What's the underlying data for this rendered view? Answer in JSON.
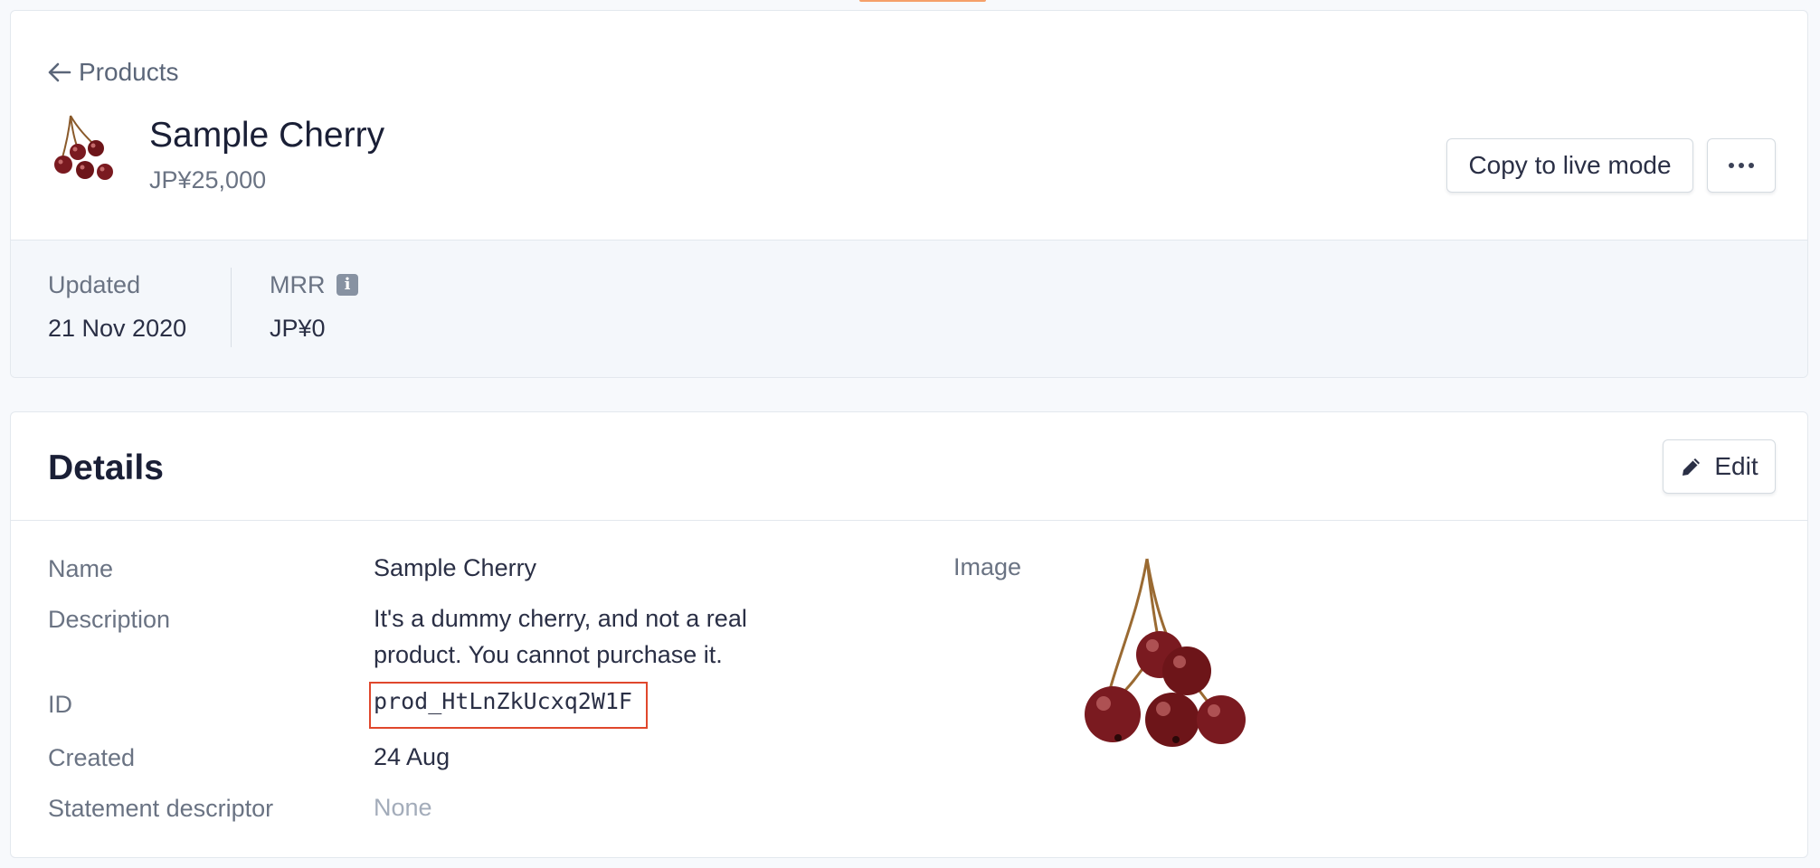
{
  "header": {
    "back_label": "Products",
    "product_name": "Sample Cherry",
    "price": "JP¥25,000",
    "copy_button_label": "Copy to live mode"
  },
  "stats": {
    "updated_label": "Updated",
    "updated_value": "21 Nov 2020",
    "mrr_label": "MRR",
    "mrr_value": "JP¥0"
  },
  "details": {
    "heading": "Details",
    "edit_label": "Edit",
    "rows": [
      {
        "label": "Name",
        "value": "Sample Cherry"
      },
      {
        "label": "Description",
        "value": "It's a dummy cherry, and not a real"
      },
      {
        "label": "Description",
        "value": "product. You cannot purchase it."
      },
      {
        "label": "ID",
        "value": "prod_HtLnZkUcxq2W1F"
      },
      {
        "label": "Created",
        "value": "24 Aug"
      },
      {
        "label": "Statement descriptor",
        "value": "None"
      }
    ],
    "image_label": "Image"
  },
  "colors": {
    "accent_orange": "#f5a06a",
    "highlight_red": "#e0472c",
    "cherry_red": "#7a1a20"
  },
  "icons": [
    "arrow-left-icon",
    "more-dots-icon",
    "info-icon",
    "pencil-icon",
    "cherry-image"
  ]
}
